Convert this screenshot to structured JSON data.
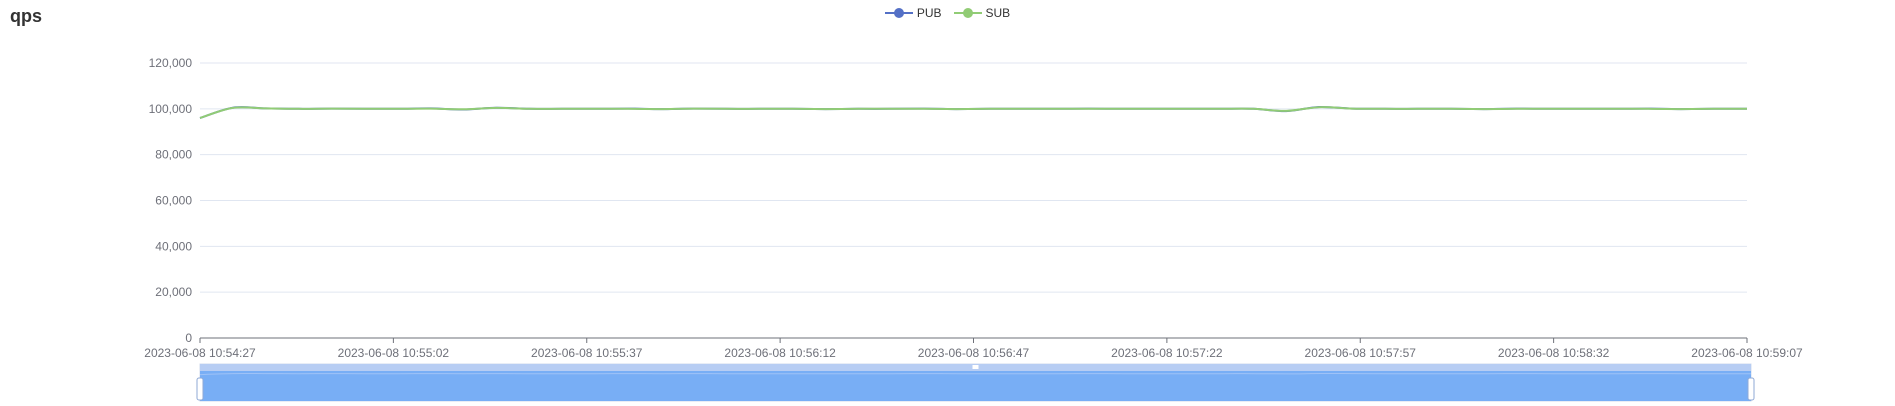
{
  "chart_data": {
    "type": "line",
    "title": "qps",
    "legend_placement": "top-center",
    "grid": true,
    "ylim": [
      0,
      120000
    ],
    "y_ticks": [
      "0",
      "20,000",
      "40,000",
      "60,000",
      "80,000",
      "100,000",
      "120,000"
    ],
    "x_ticks": [
      "2023-06-08 10:54:27",
      "2023-06-08 10:55:02",
      "2023-06-08 10:55:37",
      "2023-06-08 10:56:12",
      "2023-06-08 10:56:47",
      "2023-06-08 10:57:22",
      "2023-06-08 10:57:57",
      "2023-06-08 10:58:32",
      "2023-06-08 10:59:07"
    ],
    "x_range": [
      "2023-06-08 10:54:27",
      "2023-06-08 10:59:07"
    ],
    "series": [
      {
        "name": "PUB",
        "color": "#5470c6",
        "values": [
          96000,
          100500,
          100200,
          100000,
          100100,
          100000,
          100000,
          100200,
          99700,
          100500,
          100000,
          100000,
          100000,
          100100,
          99900,
          100100,
          100000,
          100000,
          100000,
          99900,
          100000,
          100000,
          100100,
          99900,
          100000,
          100000,
          100000,
          100100,
          100000,
          100000,
          100000,
          100000,
          100000,
          99000,
          100800,
          100100,
          100000,
          100000,
          100000,
          99900,
          100100,
          100000,
          100000,
          100000,
          100100,
          99900,
          100000,
          100000
        ]
      },
      {
        "name": "SUB",
        "color": "#91cc75",
        "values": [
          96000,
          100400,
          100200,
          100000,
          100100,
          100000,
          100000,
          100100,
          99800,
          100400,
          100000,
          100000,
          100000,
          100000,
          99900,
          100100,
          100000,
          100000,
          100000,
          99900,
          100000,
          100000,
          100000,
          99900,
          100000,
          100000,
          100000,
          100000,
          100000,
          100000,
          100000,
          100000,
          100000,
          99100,
          100700,
          100100,
          100000,
          100000,
          100000,
          99900,
          100000,
          100000,
          100000,
          100000,
          100000,
          99900,
          100000,
          100000
        ]
      }
    ]
  }
}
